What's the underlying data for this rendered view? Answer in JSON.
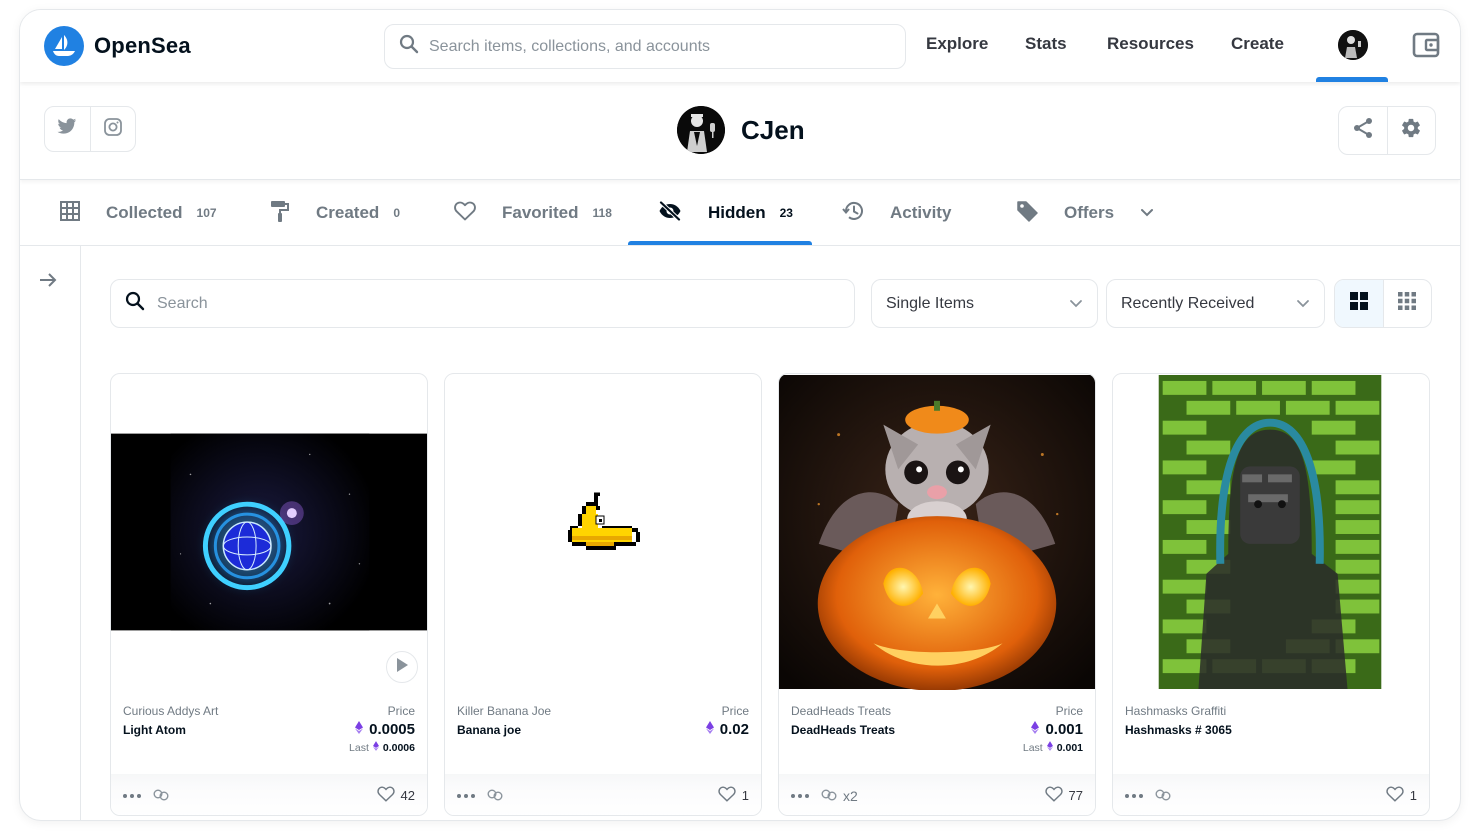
{
  "brand": {
    "name": "OpenSea",
    "accent": "#2081e2"
  },
  "nav": {
    "search_placeholder": "Search items, collections, and accounts",
    "links": [
      "Explore",
      "Stats",
      "Resources",
      "Create"
    ]
  },
  "profile": {
    "username": "CJen"
  },
  "tabs": [
    {
      "label": "Collected",
      "count": "107",
      "icon": "grid-icon"
    },
    {
      "label": "Created",
      "count": "0",
      "icon": "paint-roller-icon"
    },
    {
      "label": "Favorited",
      "count": "118",
      "icon": "heart-icon"
    },
    {
      "label": "Hidden",
      "count": "23",
      "icon": "eye-off-icon",
      "active": true
    },
    {
      "label": "Activity",
      "count": "",
      "icon": "history-icon"
    },
    {
      "label": "Offers",
      "count": "",
      "icon": "tag-icon"
    }
  ],
  "filters": {
    "search_placeholder": "Search",
    "item_type": "Single Items",
    "sort": "Recently Received"
  },
  "cards": [
    {
      "collection": "Curious Addys Art",
      "name": "Light Atom",
      "price_label": "Price",
      "price": "0.0005",
      "last_label": "Last",
      "last_price": "0.0006",
      "likes": "42",
      "copies": ""
    },
    {
      "collection": "Killer Banana Joe",
      "name": "Banana joe",
      "price_label": "Price",
      "price": "0.02",
      "last_label": "",
      "last_price": "",
      "likes": "1",
      "copies": ""
    },
    {
      "collection": "DeadHeads Treats",
      "name": "DeadHeads Treats",
      "price_label": "Price",
      "price": "0.001",
      "last_label": "Last",
      "last_price": "0.001",
      "likes": "77",
      "copies": "x2"
    },
    {
      "collection": "Hashmasks Graffiti",
      "name": "Hashmasks # 3065",
      "price_label": "",
      "price": "",
      "last_label": "",
      "last_price": "",
      "likes": "1",
      "copies": ""
    }
  ]
}
